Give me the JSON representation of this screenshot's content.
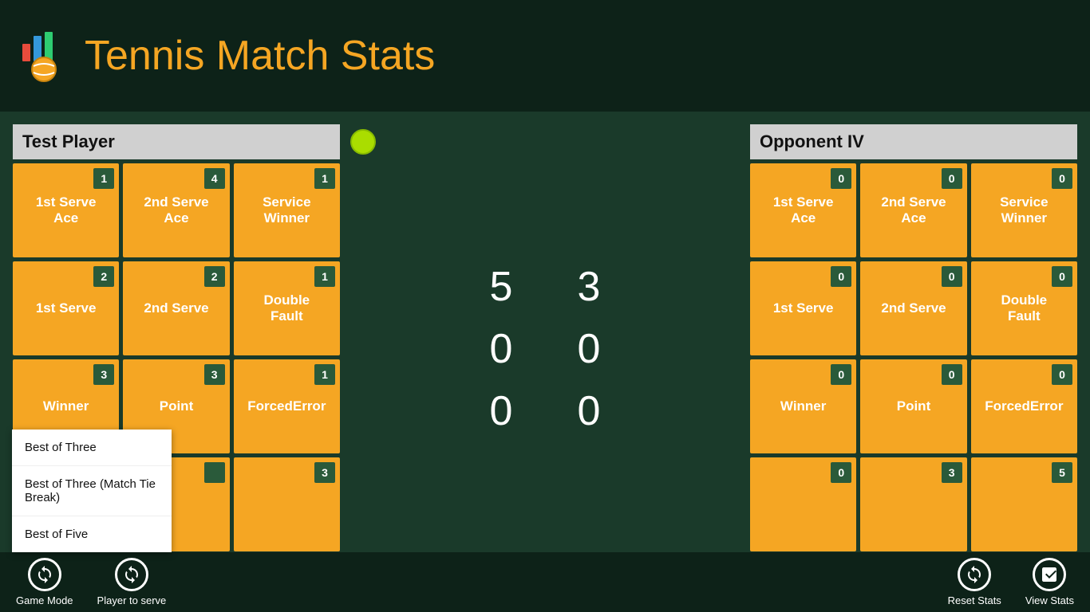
{
  "app": {
    "title": "Tennis Match Stats"
  },
  "header": {
    "title": "Tennis Match Stats"
  },
  "player1": {
    "name": "Test Player",
    "has_serve": true,
    "tiles": [
      {
        "label": "1st Serve Ace",
        "count": 1
      },
      {
        "label": "2nd Serve Ace",
        "count": 4
      },
      {
        "label": "Service Winner",
        "count": 1
      },
      {
        "label": "1st Serve",
        "count": 2
      },
      {
        "label": "2nd Serve",
        "count": 2
      },
      {
        "label": "Double Fault",
        "count": 1
      },
      {
        "label": "Winner",
        "count": 3
      },
      {
        "label": "Point",
        "count": 3
      },
      {
        "label": "ForcedError",
        "count": 1
      },
      {
        "label": "",
        "count": 3
      }
    ]
  },
  "player2": {
    "name": "Opponent IV",
    "has_serve": false,
    "tiles": [
      {
        "label": "1st Serve Ace",
        "count": 0
      },
      {
        "label": "2nd Serve Ace",
        "count": 0
      },
      {
        "label": "Service Winner",
        "count": 0
      },
      {
        "label": "1st Serve",
        "count": 0
      },
      {
        "label": "2nd Serve",
        "count": 0
      },
      {
        "label": "Double Fault",
        "count": 0
      },
      {
        "label": "Winner",
        "count": 0
      },
      {
        "label": "Point",
        "count": 0
      },
      {
        "label": "ForcedError",
        "count": 0
      },
      {
        "label": "",
        "count": 0
      },
      {
        "label": "",
        "count": 3
      },
      {
        "label": "",
        "count": 5
      }
    ]
  },
  "scores": [
    {
      "p1": "5",
      "p2": "3"
    },
    {
      "p1": "0",
      "p2": "0"
    },
    {
      "p1": "0",
      "p2": "0"
    }
  ],
  "dropdown": {
    "items": [
      "Best of Three",
      "Best of Three (Match Tie Break)",
      "Best of Five"
    ]
  },
  "footer": {
    "game_mode_label": "Game Mode",
    "player_serve_label": "Player to serve",
    "reset_stats_label": "Reset Stats",
    "view_stats_label": "View Stats"
  }
}
